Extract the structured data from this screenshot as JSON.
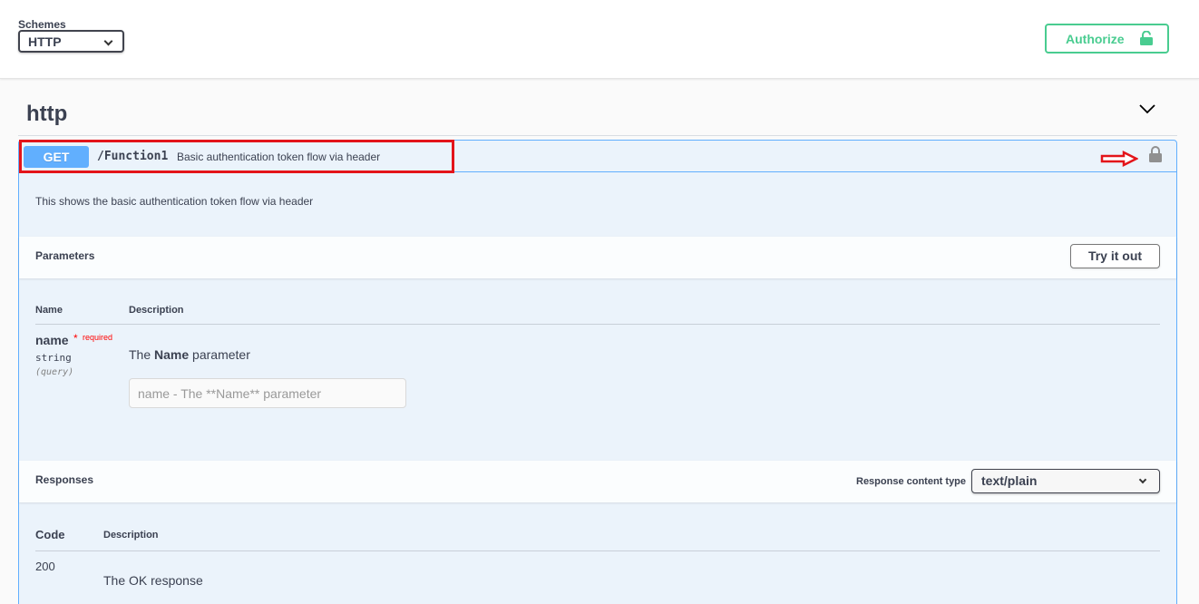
{
  "schemes": {
    "label": "Schemes",
    "selected": "HTTP"
  },
  "authorize": {
    "label": "Authorize",
    "color": "#49cc90"
  },
  "tag": {
    "title": "http"
  },
  "operation": {
    "method": "GET",
    "method_color": "#61affe",
    "path": "/Function1",
    "summary": "Basic authentication token flow via header",
    "description": "This shows the basic authentication token flow via header",
    "highlight_color": "#e3141a",
    "lock_icon": "lock-icon"
  },
  "parameters": {
    "title": "Parameters",
    "try_label": "Try it out",
    "columns": {
      "name": "Name",
      "description": "Description"
    },
    "items": [
      {
        "name": "name",
        "star": "*",
        "required": "required",
        "type": "string",
        "in": "(query)",
        "desc_prefix": "The ",
        "desc_bold": "Name",
        "desc_suffix": " parameter",
        "placeholder": "name - The **Name** parameter",
        "value": ""
      }
    ]
  },
  "responses": {
    "title": "Responses",
    "content_type_label": "Response content type",
    "content_type": "text/plain",
    "columns": {
      "code": "Code",
      "description": "Description"
    },
    "items": [
      {
        "code": "200",
        "description": "The OK response"
      }
    ]
  }
}
